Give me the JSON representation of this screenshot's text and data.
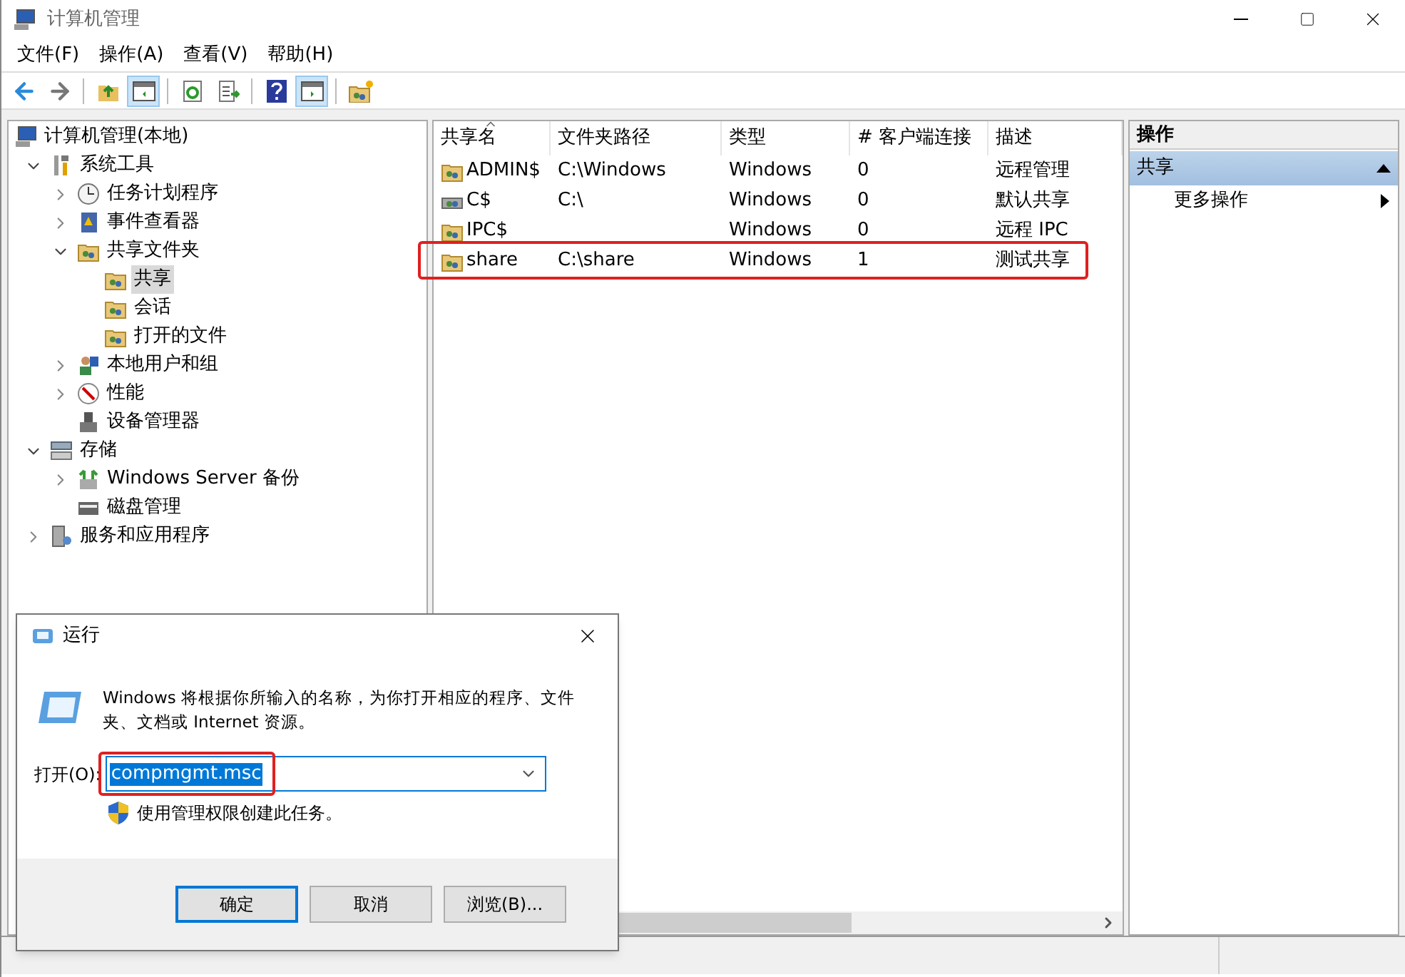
{
  "window": {
    "title": "计算机管理"
  },
  "menu": [
    "文件(F)",
    "操作(A)",
    "查看(V)",
    "帮助(H)"
  ],
  "toolbar": [
    {
      "kind": "back",
      "pressed": false
    },
    {
      "kind": "forward",
      "pressed": false
    },
    {
      "kind": "sep"
    },
    {
      "kind": "up",
      "pressed": false
    },
    {
      "kind": "tree",
      "pressed": true
    },
    {
      "kind": "sep"
    },
    {
      "kind": "refresh",
      "pressed": false
    },
    {
      "kind": "export",
      "pressed": false
    },
    {
      "kind": "sep"
    },
    {
      "kind": "help",
      "pressed": false
    },
    {
      "kind": "pane",
      "pressed": true
    },
    {
      "kind": "sep"
    },
    {
      "kind": "newshare",
      "pressed": false
    }
  ],
  "tree": {
    "label": "计算机管理(本地)",
    "children": [
      {
        "label": "系统工具",
        "expanded": true,
        "selected": false,
        "children": [
          {
            "label": "任务计划程序",
            "expanded": false,
            "selected": false
          },
          {
            "label": "事件查看器",
            "expanded": false,
            "selected": false
          },
          {
            "label": "共享文件夹",
            "expanded": true,
            "selected": false,
            "children": [
              {
                "label": "共享",
                "selected": true
              },
              {
                "label": "会话",
                "selected": false
              },
              {
                "label": "打开的文件",
                "selected": false
              }
            ]
          },
          {
            "label": "本地用户和组",
            "expanded": false,
            "selected": false
          },
          {
            "label": "性能",
            "expanded": false,
            "selected": false
          },
          {
            "label": "设备管理器",
            "selected": false
          }
        ]
      },
      {
        "label": "存储",
        "expanded": true,
        "selected": false,
        "children": [
          {
            "label": "Windows Server 备份",
            "expanded": false,
            "selected": false
          },
          {
            "label": "磁盘管理",
            "selected": false
          }
        ]
      },
      {
        "label": "服务和应用程序",
        "expanded": false,
        "selected": false
      }
    ]
  },
  "table": {
    "columns": [
      "共享名",
      "文件夹路径",
      "类型",
      "# 客户端连接",
      "描述"
    ],
    "rows": [
      {
        "cells": [
          "ADMIN$",
          "C:\\Windows",
          "Windows",
          "0",
          "远程管理"
        ],
        "highlighted": false
      },
      {
        "cells": [
          "C$",
          "C:\\",
          "Windows",
          "0",
          "默认共享"
        ],
        "highlighted": false
      },
      {
        "cells": [
          "IPC$",
          "",
          "Windows",
          "0",
          "远程 IPC"
        ],
        "highlighted": false
      },
      {
        "cells": [
          "share",
          "C:\\share",
          "Windows",
          "1",
          "测试共享"
        ],
        "highlighted": true
      }
    ]
  },
  "actions": {
    "title": "操作",
    "section": {
      "label": "共享",
      "expanded": true
    },
    "items": [
      "更多操作"
    ]
  },
  "run_dialog": {
    "title": "运行",
    "description": "Windows 将根据你所输入的名称，为你打开相应的程序、文件夹、文档或 Internet 资源。",
    "open_label": "打开(O):",
    "value": "compmgmt.msc",
    "text_selected": true,
    "highlighted": true,
    "admin_note": "使用管理权限创建此任务。",
    "buttons": [
      {
        "label": "确定",
        "default": true
      },
      {
        "label": "取消",
        "default": false
      },
      {
        "label": "浏览(B)...",
        "default": false
      }
    ]
  }
}
